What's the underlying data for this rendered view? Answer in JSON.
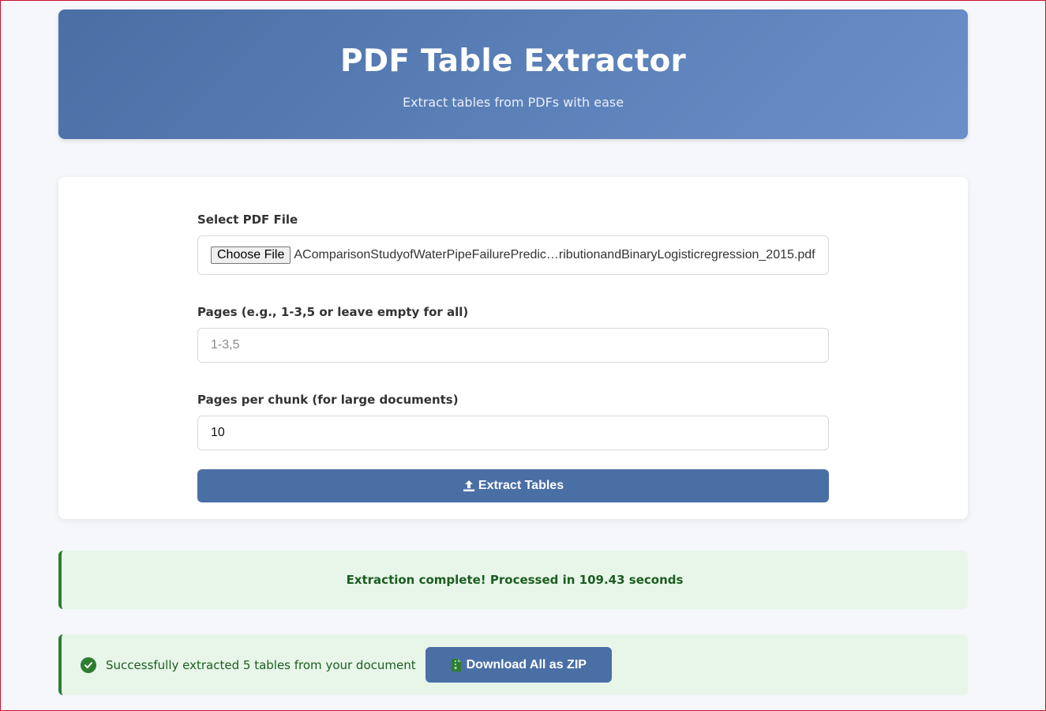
{
  "header": {
    "title": "PDF Table Extractor",
    "subtitle": "Extract tables from PDFs with ease"
  },
  "form": {
    "file_label": "Select PDF File",
    "choose_file_label": "Choose File",
    "file_name": "AComparisonStudyofWaterPipeFailurePredic…ributionandBinaryLogisticregression_2015.pdf",
    "pages_label": "Pages (e.g., 1-3,5 or leave empty for all)",
    "pages_placeholder": "1-3,5",
    "pages_value": "",
    "chunk_label": "Pages per chunk (for large documents)",
    "chunk_value": "10",
    "extract_label": "Extract Tables"
  },
  "status": {
    "message": "Extraction complete! Processed in 109.43 seconds"
  },
  "result": {
    "message": "Successfully extracted 5 tables from your document",
    "download_label": "Download All as ZIP"
  },
  "icons": {
    "extract": "upload-icon",
    "success": "check-circle-icon",
    "download": "file-archive-icon"
  },
  "colors": {
    "primary": "#4a6fa5",
    "success_bg": "#e8f5e9",
    "success_text": "#1b5e20",
    "success_icon": "#2e7d32",
    "zip_icon": "#2e7d32"
  }
}
